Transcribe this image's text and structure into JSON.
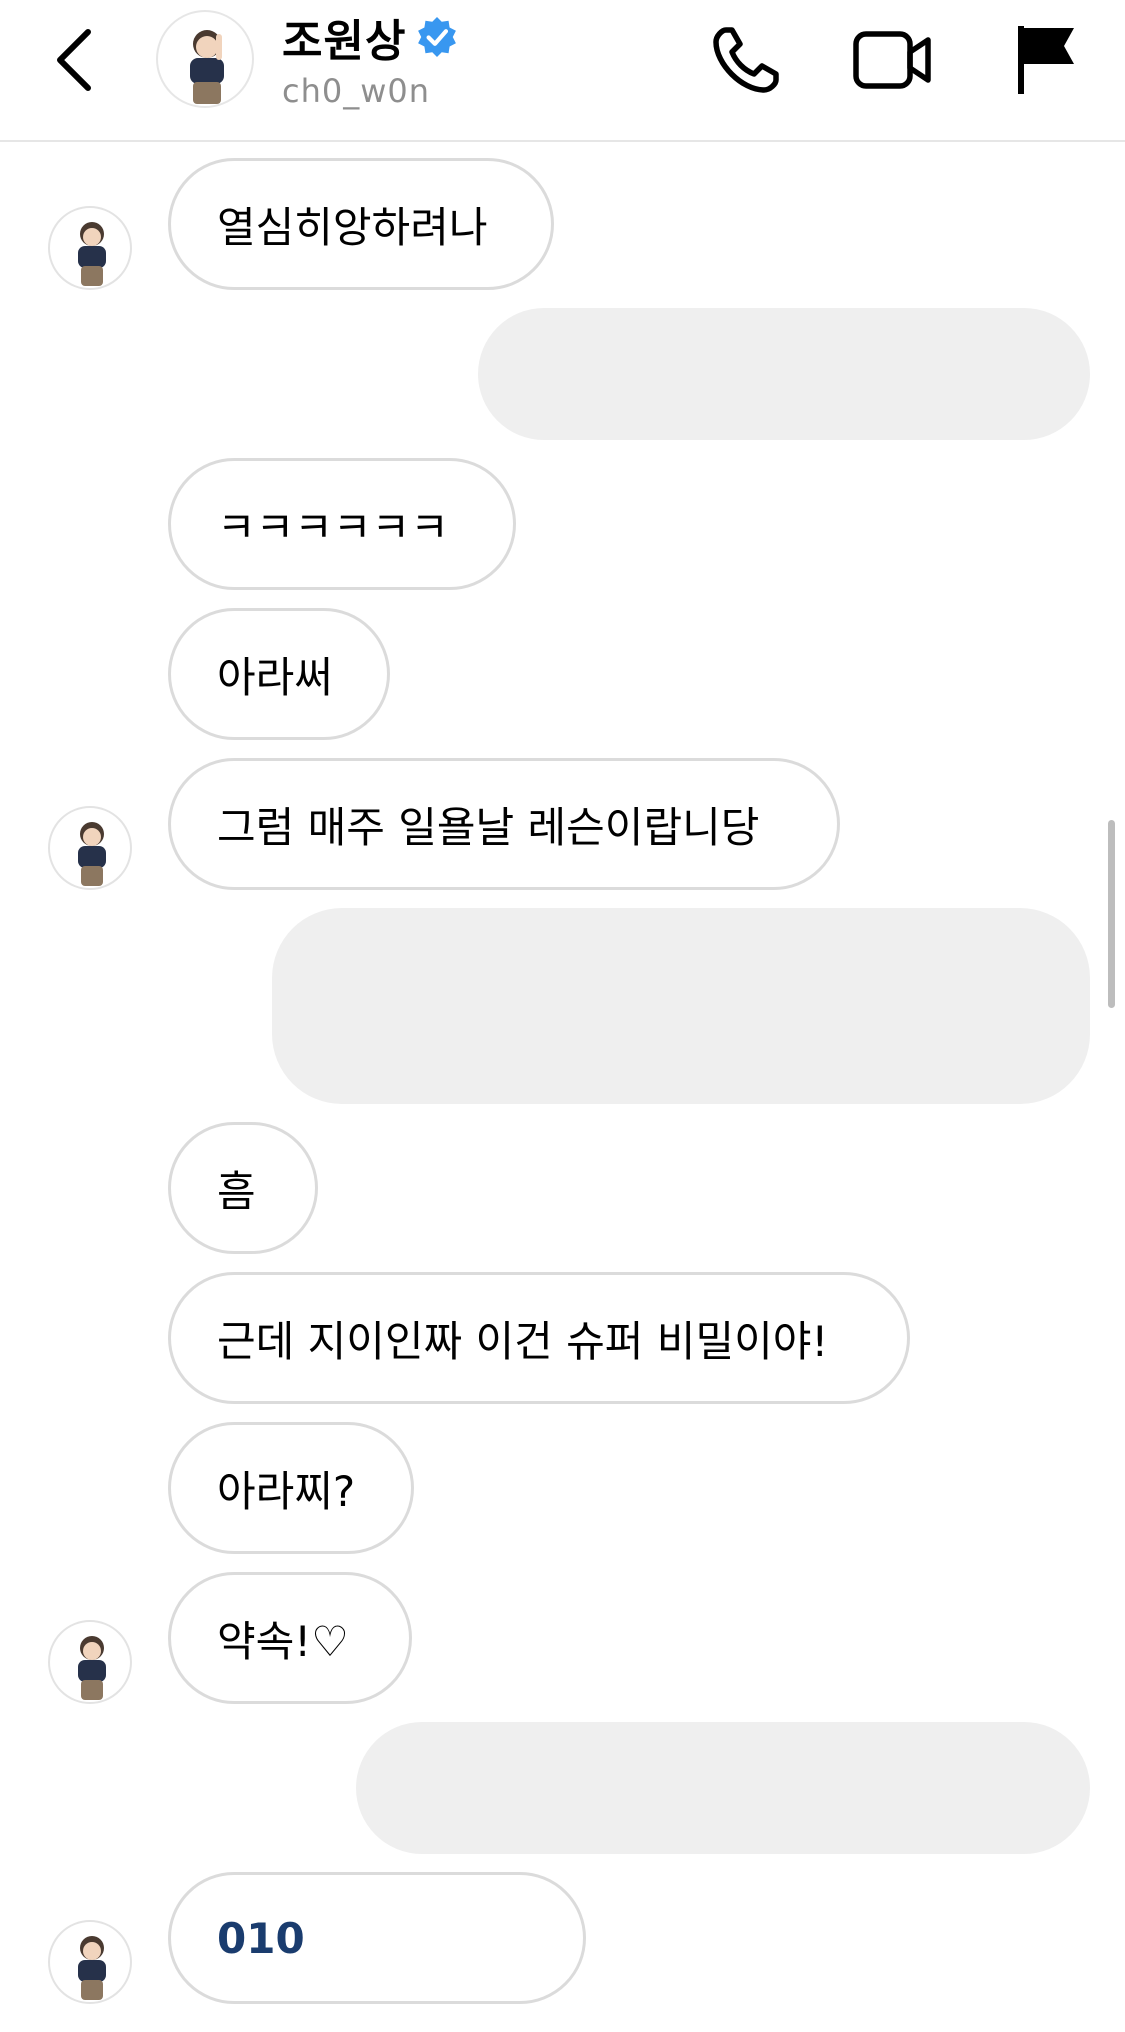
{
  "header": {
    "title": "조원상",
    "handle": "ch0_w0n",
    "icons": {
      "back": "chevron-left-icon",
      "verified": "verified-badge-icon",
      "call": "phone-icon",
      "video": "video-camera-icon",
      "report": "flag-icon"
    },
    "verified_color": "#3897f0"
  },
  "messages": [
    {
      "side": "left",
      "text": "열심히앙하려나"
    },
    {
      "side": "right",
      "text": ""
    },
    {
      "side": "left",
      "text": "ㅋㅋㅋㅋㅋㅋ"
    },
    {
      "side": "left",
      "text": "아라써"
    },
    {
      "side": "left",
      "text": "그럼 매주 일욜날 레슨이랍니당"
    },
    {
      "side": "right",
      "text": ""
    },
    {
      "side": "left",
      "text": "흠"
    },
    {
      "side": "left",
      "text": "근데 지이인짜 이건 슈퍼 비밀이야!"
    },
    {
      "side": "left",
      "text": "아라찌?"
    },
    {
      "side": "left",
      "text": "약속!♡"
    },
    {
      "side": "right",
      "text": ""
    },
    {
      "side": "left",
      "text": "010"
    }
  ],
  "colors": {
    "bubble_border": "#dbdbdb",
    "sent_bubble": "#efefef",
    "link_text": "#1a3c6e"
  }
}
